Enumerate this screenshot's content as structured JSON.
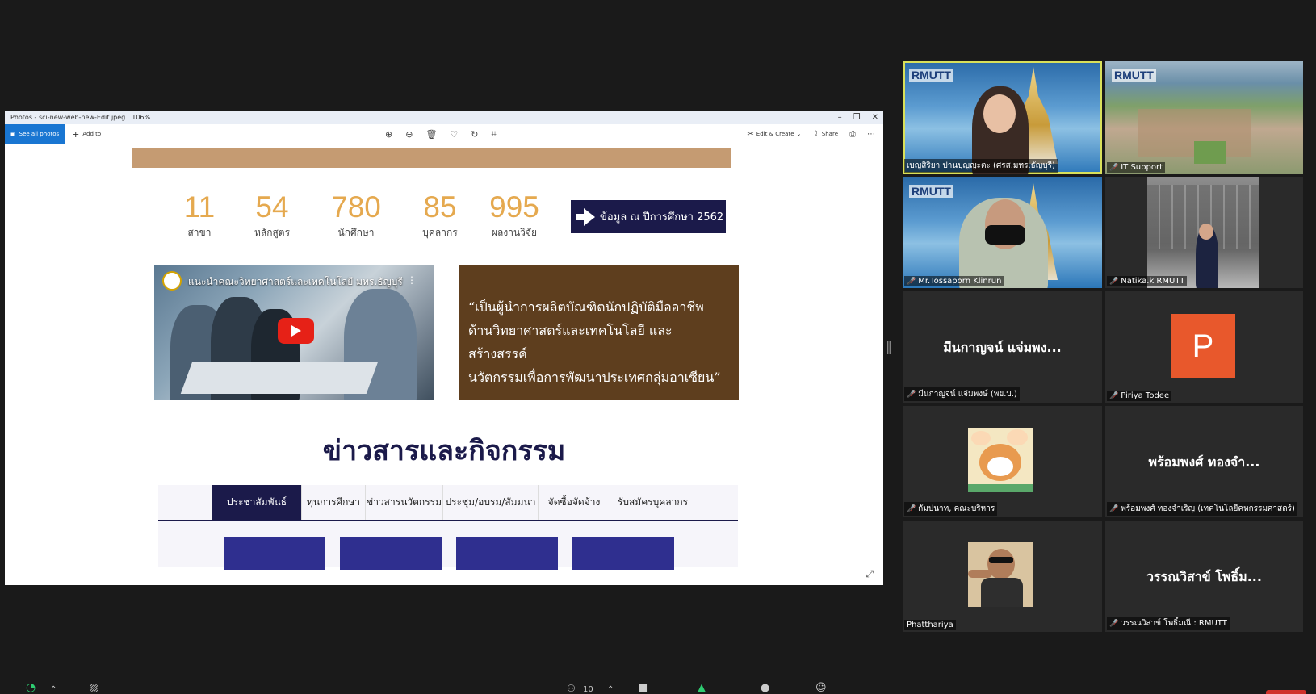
{
  "window": {
    "title": "Photos - sci-new-web-new-Edit.jpeg",
    "zoom": "106%",
    "controls": [
      "–",
      "❐",
      "✕"
    ]
  },
  "toolbar": {
    "see_all": "See all photos",
    "add_to": "Add to",
    "edit_create": "Edit & Create",
    "share": "Share"
  },
  "stats": [
    {
      "value": "11",
      "label": "สาขา"
    },
    {
      "value": "54",
      "label": "หลักสูตร"
    },
    {
      "value": "780",
      "label": "นักศึกษา"
    },
    {
      "value": "85",
      "label": "บุคลากร"
    },
    {
      "value": "995",
      "label": "ผลงานวิจัย"
    }
  ],
  "info_button": "ข้อมูล ณ ปีการศึกษา 2562",
  "video": {
    "title": "แนะนำคณะวิทยาศาสตร์และเทคโนโลยี มทร.ธัญบุรี"
  },
  "quote": {
    "line1": "“เป็นผู้นำการผลิตบัณฑิตนักปฏิบัติมืออาชีพ",
    "line2": "ด้านวิทยาศาสตร์และเทคโนโลยี และสร้างสรรค์",
    "line3": "นวัตกรรมเพื่อการพัฒนาประเทศกลุ่มอาเซียน”"
  },
  "news_title": "ข่าวสารและกิจกรรม",
  "tabs": [
    {
      "label": "ประชาสัมพันธ์",
      "active": true
    },
    {
      "label": "ทุนการศึกษา",
      "active": false
    },
    {
      "label": "ข่าวสารนวัตกรรม",
      "active": false
    },
    {
      "label": "ประชุม/อบรม/สัมมนา",
      "active": false
    },
    {
      "label": "จัดซื้อจัดจ้าง",
      "active": false
    },
    {
      "label": "รับสมัครบุคลากร",
      "active": false
    }
  ],
  "participants": [
    {
      "name": "เบญสิริยา ปานปุญญะตะ (ศรส.มทร.ธัญบุรี)",
      "logo": "RMUTT"
    },
    {
      "name": "IT Support",
      "logo": "RMUTT"
    },
    {
      "name": "Mr.Tossaporn Klinrun",
      "logo": "RMUTT"
    },
    {
      "name": "Natika.k RMUTT"
    },
    {
      "name": "มีนกาญจน์ แจ่มพงษ์ (พย.บ.)",
      "display": "มีนกาญจน์ แจ่มพง..."
    },
    {
      "name": "Piriya Todee",
      "avatar_letter": "P"
    },
    {
      "name": "กัมปนาท, คณะบริหาร"
    },
    {
      "name": "พร้อมพงศ์ ทองจำเริญ (เทคโนโลยีคหกรรมศาสตร์)",
      "display": "พร้อมพงศ์ ทองจำ..."
    },
    {
      "name": "Phatthariya"
    },
    {
      "name": "วรรณวิสาข์ โพธิ์มณี : RMUTT",
      "display": "วรรณวิสาข์ โพธิ์ม..."
    }
  ],
  "bottombar": {
    "participants_count": "10"
  },
  "colors": {
    "navy": "#1b1a4a",
    "tan": "#c59b72",
    "brown": "#5e3e1e",
    "gold": "#e5a94f",
    "active_speaker": "#d9e05a",
    "mic_off": "#e03c31"
  }
}
